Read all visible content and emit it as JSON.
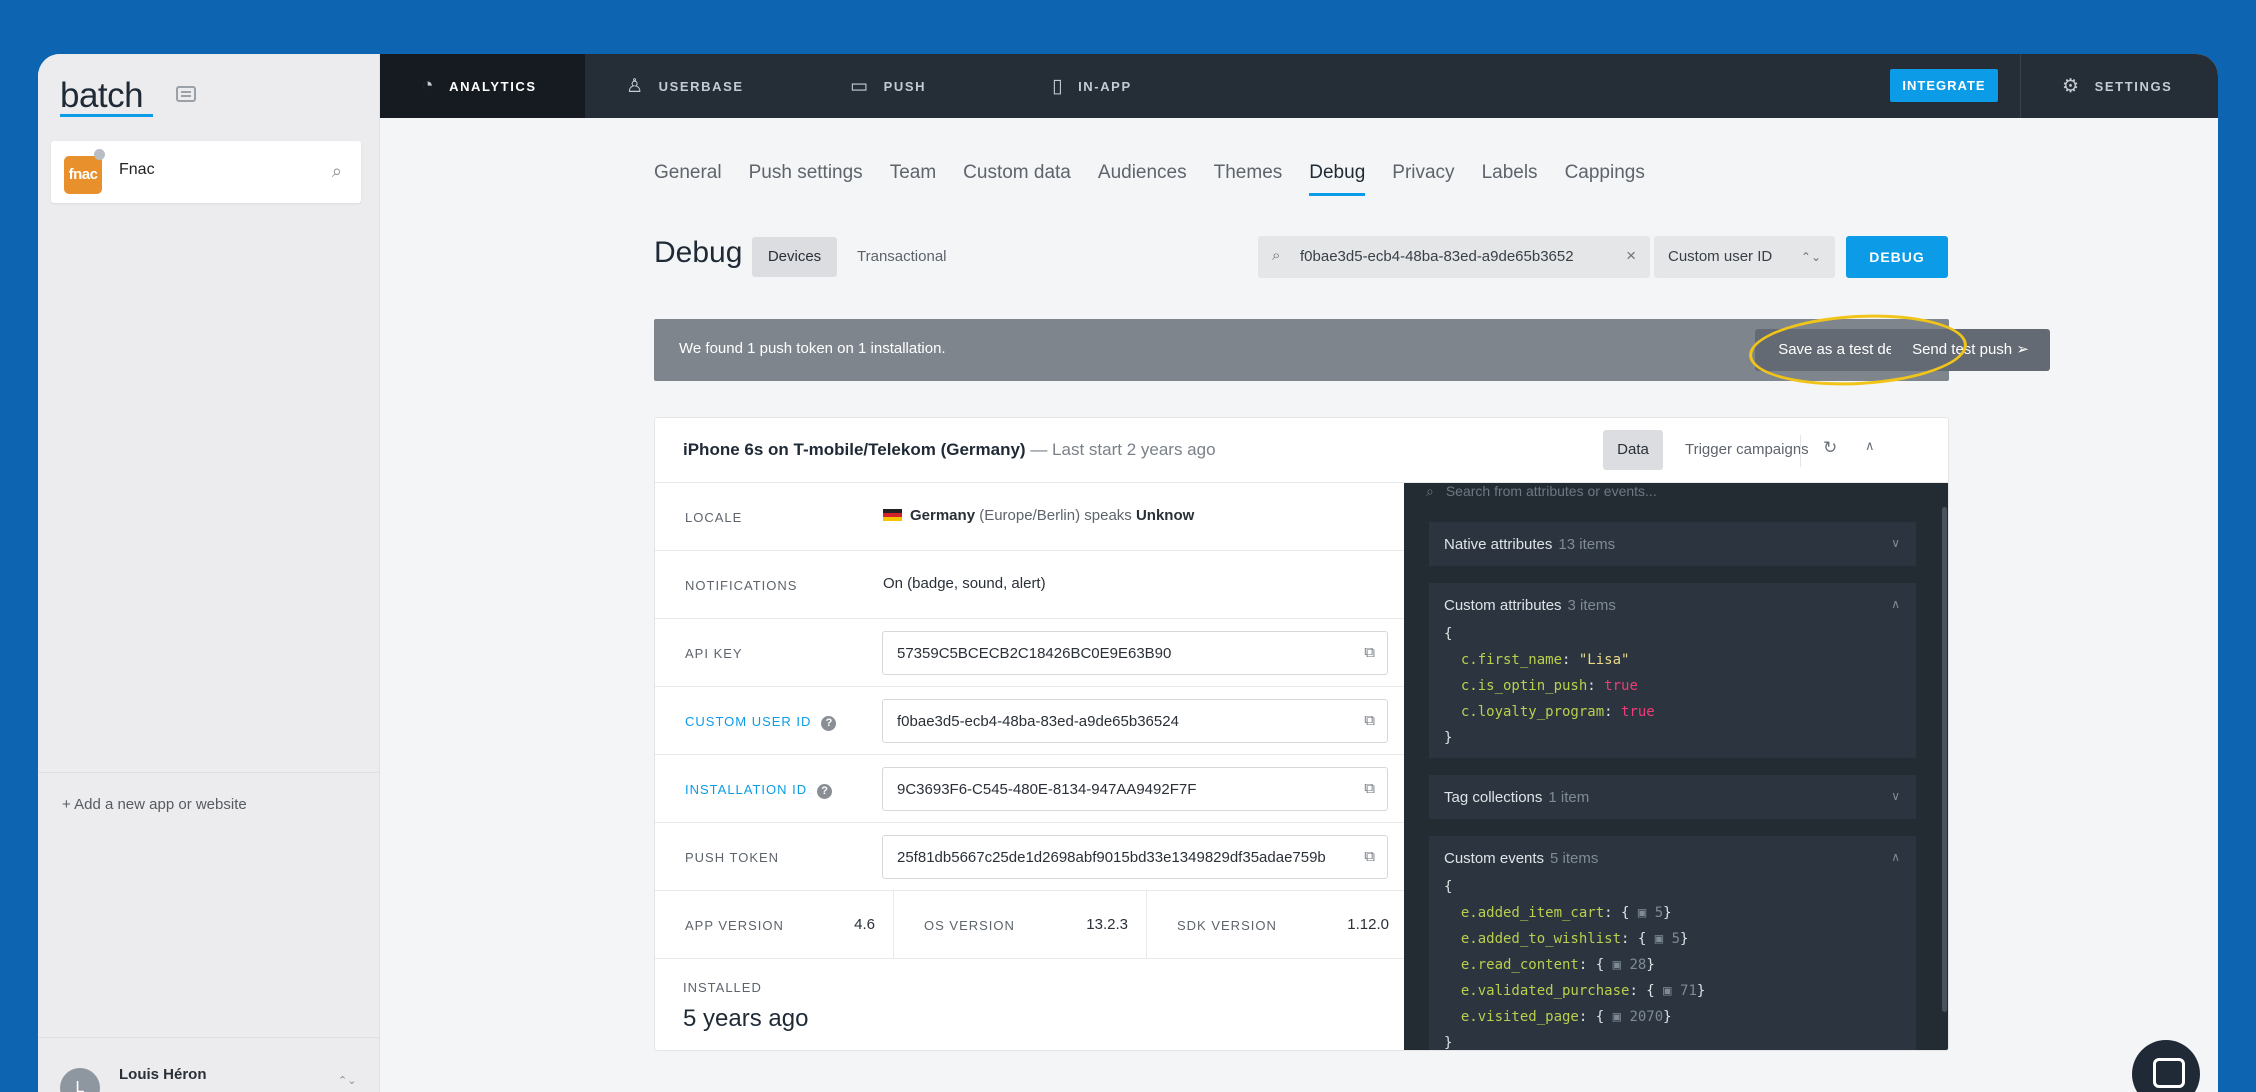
{
  "sidebar": {
    "logo": "batch",
    "app": {
      "logo_text": "fnac",
      "name": "Fnac"
    },
    "add_app": "+  Add a new app or website",
    "user": {
      "initial": "L",
      "name": "Louis Héron"
    }
  },
  "topnav": {
    "items": [
      {
        "label": "ANALYTICS",
        "icon": "analytics-icon",
        "active": true
      },
      {
        "label": "USERBASE",
        "icon": "users-icon"
      },
      {
        "label": "PUSH",
        "icon": "chat-bubble-icon"
      },
      {
        "label": "IN-APP",
        "icon": "mobile-icon"
      }
    ],
    "integrate": "INTEGRATE",
    "settings": "SETTINGS"
  },
  "subtabs": [
    "General",
    "Push settings",
    "Team",
    "Custom data",
    "Audiences",
    "Themes",
    "Debug",
    "Privacy",
    "Labels",
    "Cappings"
  ],
  "subtab_active": "Debug",
  "debug": {
    "title": "Debug",
    "seg_devices": "Devices",
    "seg_transactional": "Transactional",
    "search_value": "f0bae3d5-ecb4-48ba-83ed-a9de65b3652",
    "id_type": "Custom user ID",
    "debug_button": "DEBUG"
  },
  "banner": {
    "text": "We found 1 push token on 1 installation.",
    "save_test": "Save as a test device",
    "send_test": "Send test push"
  },
  "device": {
    "name": "iPhone 6s on T-mobile/Telekom (Germany)",
    "last_start": "— Last start 2 years ago",
    "data_btn": "Data",
    "trigger_btn": "Trigger campaigns",
    "locale_label": "LOCALE",
    "locale_country": "Germany",
    "locale_tz": "(Europe/Berlin) speaks",
    "locale_lang": "Unknow",
    "notif_label": "NOTIFICATIONS",
    "notif_value": "On (badge, sound, alert)",
    "api_label": "API KEY",
    "api_value": "57359C5BCECB2C18426BC0E9E63B90",
    "cuid_label": "CUSTOM USER ID",
    "cuid_value": "f0bae3d5-ecb4-48ba-83ed-a9de65b36524",
    "iid_label": "INSTALLATION ID",
    "iid_value": "9C3693F6-C545-480E-8134-947AA9492F7F",
    "token_label": "PUSH TOKEN",
    "token_value": "25f81db5667c25de1d2698abf9015bd33e1349829df35adae759b",
    "app_ver_label": "APP VERSION",
    "app_ver": "4.6",
    "os_ver_label": "OS VERSION",
    "os_ver": "13.2.3",
    "sdk_ver_label": "SDK VERSION",
    "sdk_ver": "1.12.0",
    "installed_label": "INSTALLED",
    "installed_value": "5 years ago"
  },
  "attributes": {
    "search_placeholder": "Search from attributes or events...",
    "native": {
      "title": "Native attributes",
      "count": "13  items"
    },
    "custom": {
      "title": "Custom attributes",
      "count": "3  items",
      "open": "{",
      "rows": [
        {
          "key": "c.first_name",
          "value": "\"Lisa\""
        },
        {
          "key": "c.is_optin_push",
          "value": "true"
        },
        {
          "key": "c.loyalty_program",
          "value": "true"
        }
      ],
      "close": "}"
    },
    "tags": {
      "title": "Tag collections",
      "count": "1  item"
    },
    "events": {
      "title": "Custom events",
      "count": "5  items",
      "open": "{",
      "rows": [
        {
          "key": "e.added_item_cart",
          "count": "5"
        },
        {
          "key": "e.added_to_wishlist",
          "count": "5"
        },
        {
          "key": "e.read_content",
          "count": "28"
        },
        {
          "key": "e.validated_purchase",
          "count": "71"
        },
        {
          "key": "e.visited_page",
          "count": "2070"
        }
      ],
      "close": "}"
    }
  },
  "colors": {
    "accent": "#0b9be7",
    "nav_bg": "#252d36",
    "highlight": "#f0c419",
    "desktop_bg": "#0d64b0"
  }
}
